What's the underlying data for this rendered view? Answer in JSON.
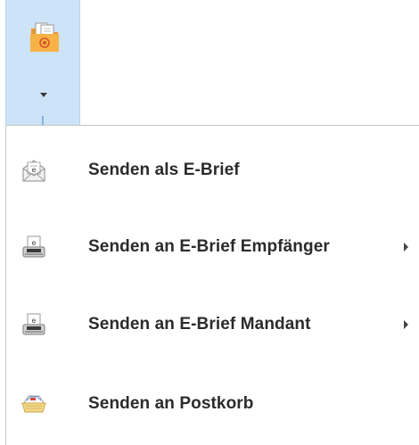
{
  "menu": {
    "items": [
      {
        "label": "Senden als E-Brief",
        "icon": "envelope-letter-icon",
        "has_submenu": false
      },
      {
        "label": "Senden an E-Brief Empfänger",
        "icon": "letter-scanner-icon",
        "has_submenu": true
      },
      {
        "label": "Senden an E-Brief Mandant",
        "icon": "letter-scanner-icon",
        "has_submenu": true
      },
      {
        "label": "Senden an Postkorb",
        "icon": "postbox-tray-icon",
        "has_submenu": false
      }
    ]
  },
  "ribbon": {
    "button_icon": "orange-folder-icon",
    "button_highlight_color": "#cde3f7",
    "folder_color": "#f5a43a"
  }
}
